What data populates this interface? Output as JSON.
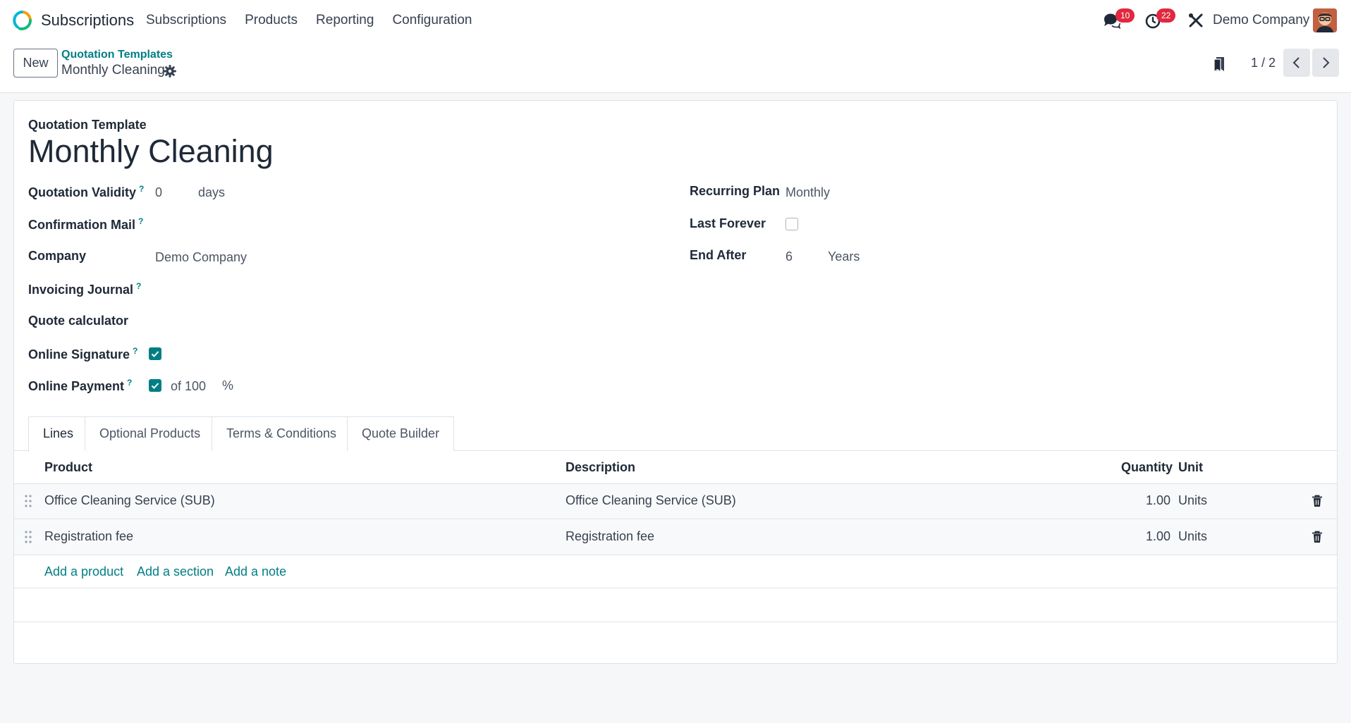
{
  "navbar": {
    "app_name": "Subscriptions",
    "menu": [
      "Subscriptions",
      "Products",
      "Reporting",
      "Configuration"
    ],
    "messages_count": "10",
    "activities_count": "22",
    "company": "Demo Company"
  },
  "control": {
    "new_label": "New",
    "breadcrumb_parent": "Quotation Templates",
    "breadcrumb_current": "Monthly Cleaning",
    "pager": "1 / 2"
  },
  "form": {
    "small_label": "Quotation Template",
    "title": "Monthly Cleaning",
    "left": {
      "validity_label": "Quotation Validity",
      "validity_value": "0",
      "validity_unit": "days",
      "mail_label": "Confirmation Mail",
      "company_label": "Company",
      "company_value": "Demo Company",
      "journal_label": "Invoicing Journal",
      "calculator_label": "Quote calculator",
      "signature_label": "Online Signature",
      "signature_checked": true,
      "payment_label": "Online Payment",
      "payment_checked": true,
      "payment_of": "of 100",
      "payment_percent": "%"
    },
    "right": {
      "plan_label": "Recurring Plan",
      "plan_value": "Monthly",
      "forever_label": "Last Forever",
      "forever_checked": false,
      "end_label": "End After",
      "end_value": "6",
      "end_unit": "Years"
    },
    "help_mark": "?"
  },
  "tabs": [
    "Lines",
    "Optional Products",
    "Terms & Conditions",
    "Quote Builder"
  ],
  "table": {
    "headers": {
      "product": "Product",
      "description": "Description",
      "quantity": "Quantity",
      "unit": "Unit"
    },
    "rows": [
      {
        "product": "Office Cleaning Service (SUB)",
        "description": "Office Cleaning Service (SUB)",
        "quantity": "1.00",
        "unit": "Units"
      },
      {
        "product": "Registration fee",
        "description": "Registration fee",
        "quantity": "1.00",
        "unit": "Units"
      }
    ],
    "add_product": "Add a product",
    "add_section": "Add a section",
    "add_note": "Add a note"
  },
  "colors": {
    "accent": "#017e84",
    "badge": "#e0293f"
  },
  "icons": [
    "app-logo-icon",
    "chat-icon",
    "clock-icon",
    "tools-icon",
    "gear-icon",
    "bookmark-icon",
    "chevron-left-icon",
    "chevron-right-icon",
    "drag-handle-icon",
    "trash-icon",
    "check-icon"
  ]
}
